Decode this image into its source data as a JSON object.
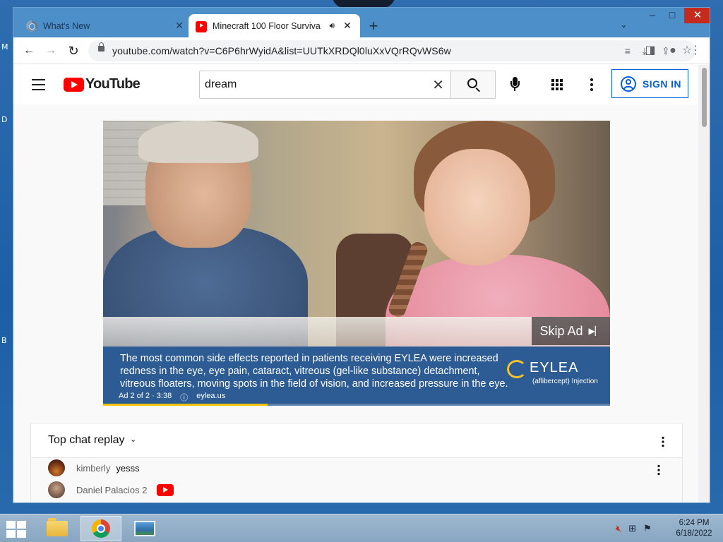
{
  "desktop": {
    "side_letters": [
      "M",
      "D",
      "B"
    ]
  },
  "browser": {
    "tabs": [
      {
        "title": "What's New",
        "active": false
      },
      {
        "title": "Minecraft 100 Floor Surviva",
        "active": true
      }
    ],
    "new_tab_label": "+",
    "tab_search_label": "⌄",
    "window_controls": {
      "minimize": "–",
      "maximize": "□",
      "close": "✕"
    },
    "toolbar": {
      "back": "←",
      "forward": "→",
      "reload": "↻",
      "url": "youtube.com/watch?v=C6P6hrWyidA&list=UUTkXRDQl0luXxVQrRQvWS6w"
    }
  },
  "youtube": {
    "logo_text": "YouTube",
    "search": {
      "value": "dream",
      "clear": "✕"
    },
    "sign_in_label": "SIGN IN",
    "video_ad": {
      "skip_label": "Skip Ad",
      "skip_icon": "▶▏",
      "caption": "The most common side effects reported in patients receiving EYLEA were increased redness in the eye, eye pain, cataract, vitreous (gel-like substance) detachment, vitreous floaters, moving spots in the field of vision, and increased pressure in the eye.",
      "brand_name": "EYLEA",
      "brand_sub": "(aflibercept) Injection",
      "ad_counter": "Ad 2 of 2 · 3:38",
      "ad_info_icon": "ⓘ",
      "advertiser": "eylea.us",
      "progress_fraction": 0.325
    },
    "chat": {
      "header_label": "Top chat replay",
      "header_chevron": "⌄",
      "messages": [
        {
          "author": "kimberly",
          "text": "yesss"
        },
        {
          "author": "Daniel Palacios 2",
          "text": ""
        }
      ]
    }
  },
  "taskbar": {
    "clock_time": "6:24 PM",
    "clock_date": "6/18/2022",
    "tray_icons": [
      "speaker-muted-icon",
      "network-icon",
      "flag-icon"
    ]
  },
  "colors": {
    "youtube_red": "#ff0000",
    "sign_in_blue": "#065fd4",
    "ad_banner": "#2c5c93",
    "ad_progress": "#f4c20d",
    "close_button": "#c42b1c"
  }
}
